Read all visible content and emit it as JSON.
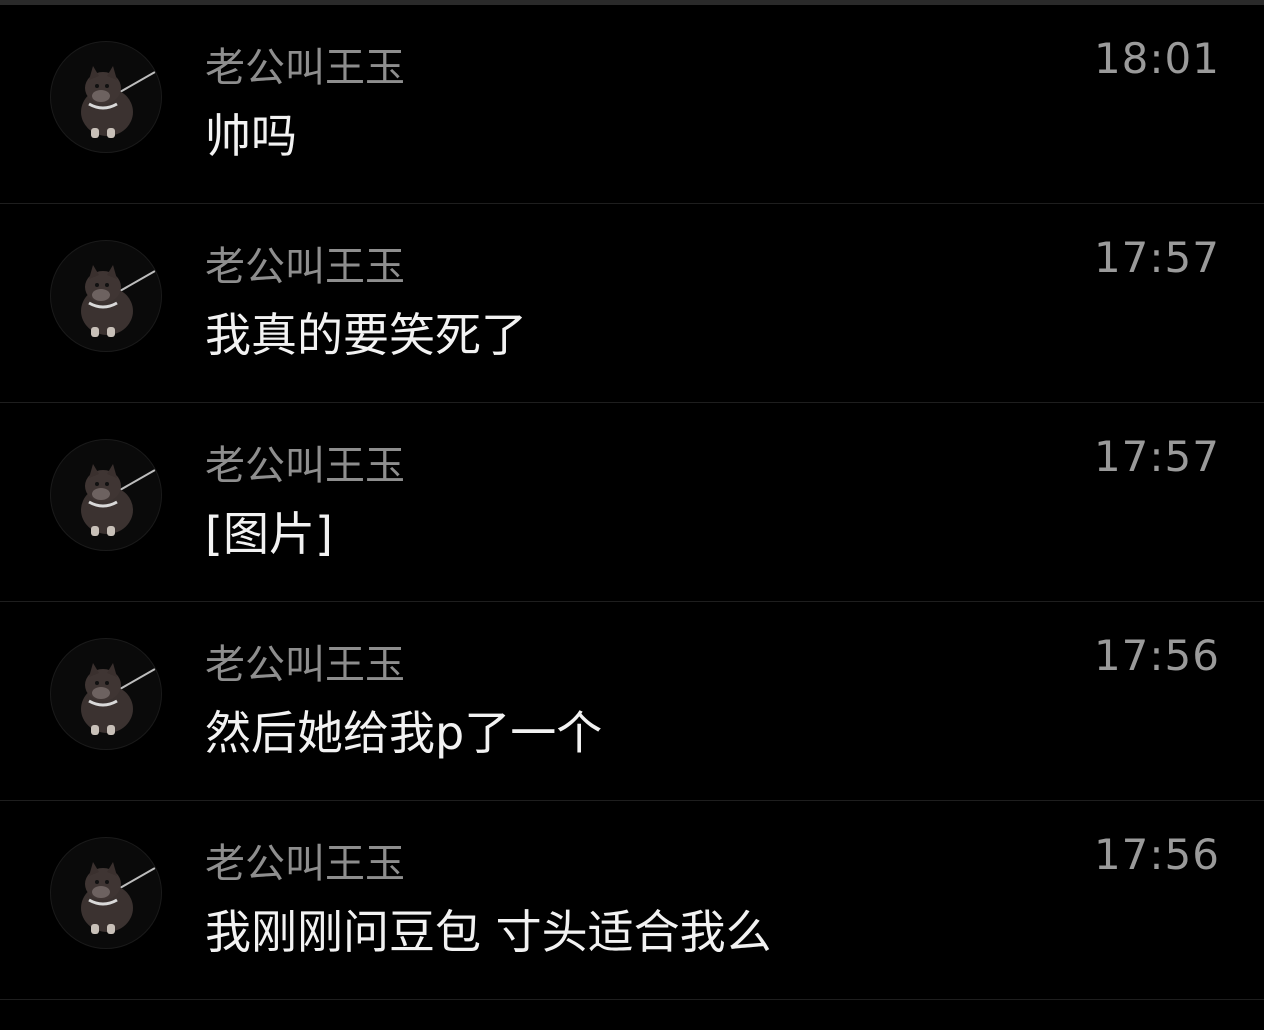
{
  "conversation": {
    "messages": [
      {
        "sender": "老公叫王玉",
        "text": "帅吗",
        "time": "18:01",
        "avatar_icon": "dog-avatar-icon"
      },
      {
        "sender": "老公叫王玉",
        "text": "我真的要笑死了",
        "time": "17:57",
        "avatar_icon": "dog-avatar-icon"
      },
      {
        "sender": "老公叫王玉",
        "text": "[图片]",
        "time": "17:57",
        "avatar_icon": "dog-avatar-icon"
      },
      {
        "sender": "老公叫王玉",
        "text": "然后她给我p了一个",
        "time": "17:56",
        "avatar_icon": "dog-avatar-icon"
      },
      {
        "sender": "老公叫王玉",
        "text": "我刚刚问豆包 寸头适合我么",
        "time": "17:56",
        "avatar_icon": "dog-avatar-icon"
      }
    ]
  },
  "colors": {
    "background": "#000000",
    "sender_text": "#8e8e8e",
    "message_text": "#f2f2f2",
    "time_text": "#9a9a9a",
    "divider": "#1e1e1e"
  }
}
